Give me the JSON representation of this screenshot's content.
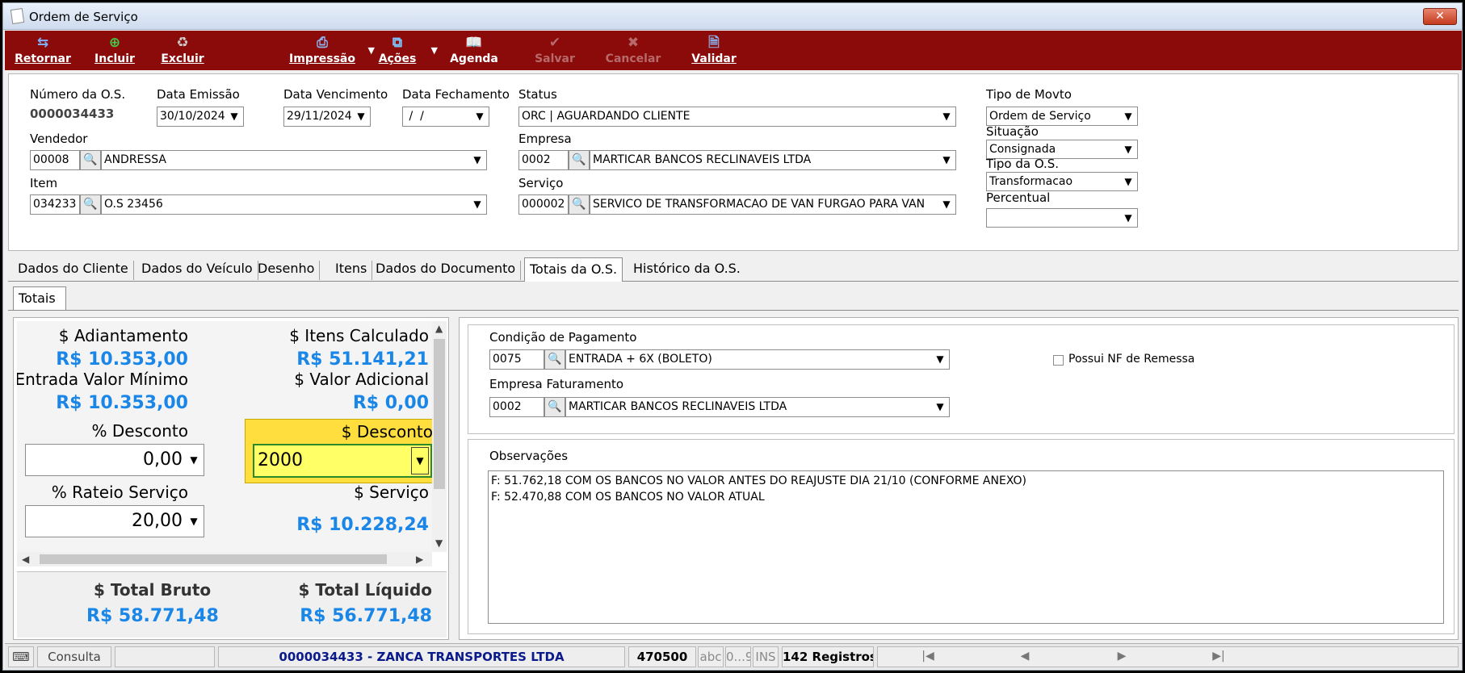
{
  "window": {
    "title": "Ordem de Serviço",
    "close_glyph": "✕"
  },
  "toolbar": {
    "retornar": "Retornar",
    "incluir": "Incluir",
    "excluir": "Excluir",
    "impressao": "Impressão",
    "acoes": "Ações",
    "agenda": "Agenda",
    "salvar": "Salvar",
    "cancelar": "Cancelar",
    "validar": "Validar"
  },
  "header": {
    "numero_label": "Número da O.S.",
    "numero_value": "0000034433",
    "emissao_label": "Data Emissão",
    "emissao_value": "30/10/2024",
    "vencimento_label": "Data Vencimento",
    "vencimento_value": "29/11/2024",
    "fechamento_label": "Data Fechamento",
    "fechamento_value": " /  /",
    "status_label": "Status",
    "status_value": "ORC | AGUARDANDO CLIENTE",
    "vendedor_label": "Vendedor",
    "vendedor_code": "00008",
    "vendedor_name": "ANDRESSA",
    "empresa_label": "Empresa",
    "empresa_code": "0002",
    "empresa_name": "MARTICAR BANCOS RECLINAVEIS LTDA",
    "item_label": "Item",
    "item_code": "034233",
    "item_name": "O.S 23456",
    "servico_label": "Serviço",
    "servico_code": "000002",
    "servico_name": "SERVICO DE TRANSFORMACAO DE VAN FURGAO PARA VAN",
    "tipo_movto_label": "Tipo de Movto",
    "tipo_movto_value": "Ordem de Serviço",
    "situacao_label": "Situação",
    "situacao_value": "Consignada",
    "tipo_os_label": "Tipo da O.S.",
    "tipo_os_value": "Transformacao",
    "percentual_label": "Percentual",
    "percentual_value": ""
  },
  "tabs": [
    "Dados do Cliente",
    "Dados do Veículo",
    "Desenho",
    "Itens",
    "Dados do Documento",
    "Totais da O.S.",
    "Histórico da O.S."
  ],
  "subtab": "Totais",
  "totais": {
    "adiantamento_label": "$ Adiantamento",
    "adiantamento_value": "R$ 10.353,00",
    "itens_calc_label": "$ Itens Calculado",
    "itens_calc_value": "R$ 51.141,21",
    "entrada_min_label": "$ Entrada Valor Mínimo",
    "entrada_min_value": "R$ 10.353,00",
    "valor_adic_label": "$ Valor Adicional",
    "valor_adic_value": "R$ 0,00",
    "pct_desconto_label": "% Desconto",
    "pct_desconto_value": "0,00",
    "desconto_label": "$ Desconto",
    "desconto_value": "2000",
    "rateio_label": "% Rateio Serviço",
    "rateio_value": "20,00",
    "servico_label": "$ Serviço",
    "servico_value": "R$ 10.228,24",
    "total_bruto_label": "$ Total Bruto",
    "total_bruto_value": "R$ 58.771,48",
    "total_liquido_label": "$ Total Líquido",
    "total_liquido_value": "R$ 56.771,48"
  },
  "pagamento": {
    "condicao_label": "Condição de Pagamento",
    "condicao_code": "0075",
    "condicao_name": "ENTRADA + 6X (BOLETO)",
    "nf_remessa_label": "Possui NF de Remessa",
    "emp_fat_label": "Empresa Faturamento",
    "emp_fat_code": "0002",
    "emp_fat_name": "MARTICAR BANCOS RECLINAVEIS LTDA"
  },
  "observacoes": {
    "label": "Observações",
    "line1": "F: 51.762,18 COM OS BANCOS NO VALOR ANTES DO REAJUSTE DIA 21/10 (CONFORME ANEXO)",
    "line2": "F: 52.470,88 COM OS BANCOS NO VALOR ATUAL"
  },
  "statusbar": {
    "mode": "Consulta",
    "record": "0000034433 - ZANCA TRANSPORTES LTDA",
    "code": "470500",
    "abc": "abc",
    "digits": "0...9",
    "ins": "INS",
    "registros": "142 Registros"
  }
}
